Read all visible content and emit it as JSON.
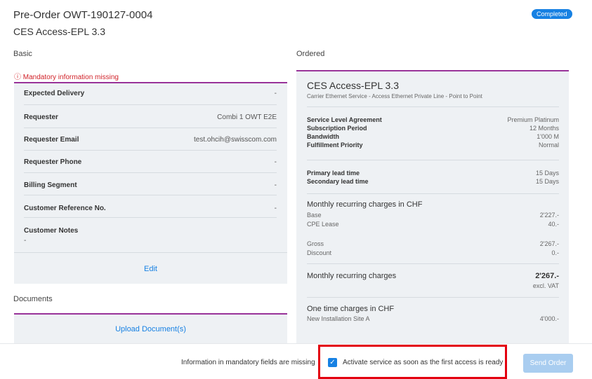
{
  "header": {
    "title": "Pre-Order OWT-190127-0004",
    "subtitle": "CES Access-EPL 3.3",
    "status_badge": "Completed"
  },
  "colors": {
    "accent": "#1781e3",
    "divider": "#993399",
    "error": "#d12229",
    "panel": "#eef1f4"
  },
  "basic": {
    "heading": "Basic",
    "error": "ⓘ Mandatory information missing",
    "rows": [
      {
        "label": "Expected Delivery",
        "value": "-"
      },
      {
        "label": "Requester",
        "value": "Combi 1 OWT E2E"
      },
      {
        "label": "Requester Email",
        "value": "test.ohcih@swisscom.com"
      },
      {
        "label": "Requester Phone",
        "value": "-"
      },
      {
        "label": "Billing Segment",
        "value": "-"
      },
      {
        "label": "Customer Reference No.",
        "value": "-"
      }
    ],
    "notes_label": "Customer Notes",
    "notes_value": "-",
    "edit_label": "Edit"
  },
  "documents": {
    "heading": "Documents",
    "upload_label": "Upload Document(s)"
  },
  "ordered": {
    "heading": "Ordered",
    "product_title": "CES Access-EPL 3.3",
    "product_desc": "Carrier Ethernet Service - Access Ethernet Private Line - Point to Point",
    "details": [
      {
        "label": "Service Level Agreement",
        "value": "Premium Platinum"
      },
      {
        "label": "Subscription Period",
        "value": "12 Months"
      },
      {
        "label": "Bandwidth",
        "value": "1'000 M"
      },
      {
        "label": "Fulfillment Priority",
        "value": "Normal"
      }
    ],
    "lead": [
      {
        "label": "Primary lead time",
        "value": "15 Days"
      },
      {
        "label": "Secondary lead time",
        "value": "15 Days"
      }
    ],
    "mrc_heading": "Monthly recurring charges in CHF",
    "mrc_items": [
      {
        "label": "Base",
        "value": "2'227.-"
      },
      {
        "label": "CPE Lease",
        "value": "40.-"
      }
    ],
    "mrc_totals": [
      {
        "label": "Gross",
        "value": "2'267.-"
      },
      {
        "label": "Discount",
        "value": "0.-"
      }
    ],
    "mrc_total_label": "Monthly recurring charges",
    "mrc_total_value": "2'267.-",
    "mrc_total_note": "excl. VAT",
    "otc_heading": "One time charges in CHF",
    "otc_label": "New Installation Site A",
    "otc_value": "4'000.-"
  },
  "footer": {
    "missing_text": "Information in mandatory fields are missing",
    "activate_label": "Activate service as soon as the first access is ready",
    "activate_checked": true,
    "send_label": "Send Order"
  }
}
